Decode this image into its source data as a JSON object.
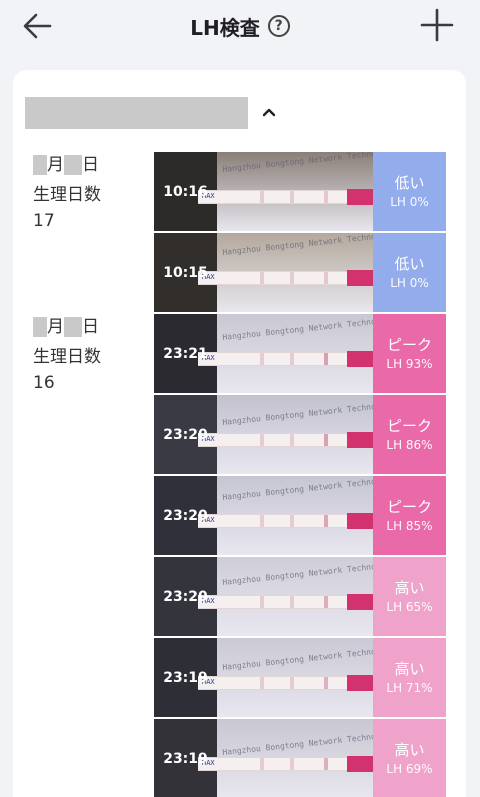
{
  "header": {
    "title": "LH検査",
    "help_glyph": "?",
    "back_icon": "arrow-left-icon",
    "add_icon": "plus-icon"
  },
  "section": {
    "collapse_icon": "chevron-up-icon"
  },
  "days": [
    {
      "month_label": "月",
      "day_label": "日",
      "cycle_label": "生理日数",
      "cycle_day": "17"
    },
    {
      "month_label": "月",
      "day_label": "日",
      "cycle_label": "生理日数",
      "cycle_day": "16"
    }
  ],
  "tests": [
    {
      "time": "10:16",
      "status": "低い",
      "lh": "LH 0%",
      "color": "#92acec"
    },
    {
      "time": "10:15",
      "status": "低い",
      "lh": "LH 0%",
      "color": "#92acec"
    },
    {
      "time": "23:21",
      "status": "ピーク",
      "lh": "LH 93%",
      "color": "#ea69a8"
    },
    {
      "time": "23:20",
      "status": "ピーク",
      "lh": "LH 86%",
      "color": "#ea69a8"
    },
    {
      "time": "23:20",
      "status": "ピーク",
      "lh": "LH 85%",
      "color": "#ea69a8"
    },
    {
      "time": "23:20",
      "status": "高い",
      "lh": "LH 65%",
      "color": "#f0a3ca"
    },
    {
      "time": "23:19",
      "status": "高い",
      "lh": "LH 71%",
      "color": "#f0a3ca"
    },
    {
      "time": "23:19",
      "status": "高い",
      "lh": "LH 69%",
      "color": "#f0a3ca"
    }
  ],
  "strip": {
    "max_label": "MAX",
    "print_text": "Hangzhou Bongtong Network Technology"
  },
  "colors": {
    "background": "#f2f3f7",
    "card": "#ffffff",
    "low": "#92acec",
    "peak": "#ea69a8",
    "high": "#f0a3ca"
  }
}
